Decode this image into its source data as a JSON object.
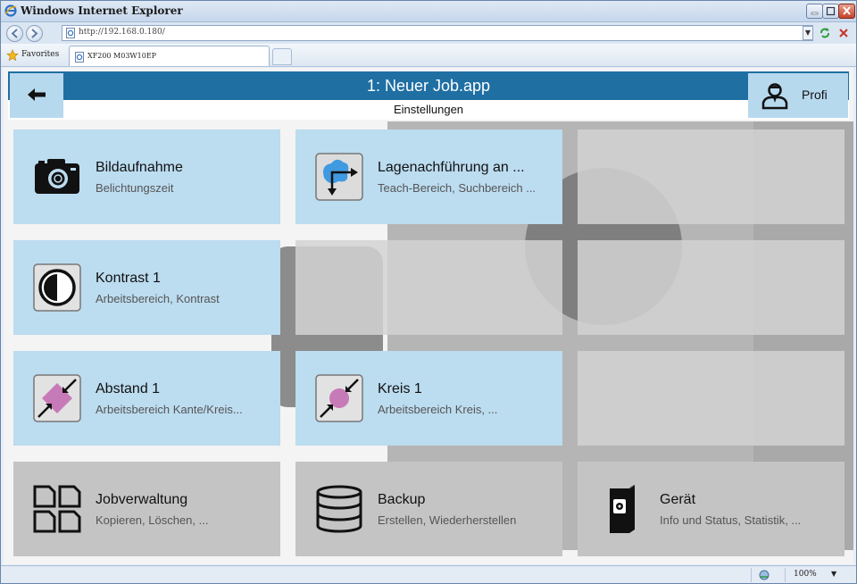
{
  "window": {
    "title": "Windows Internet Explorer"
  },
  "address_bar": {
    "url": "http://192.168.0.180/"
  },
  "favorites": {
    "label": "Favorites",
    "tab_label": "XF200 M03W10EP"
  },
  "app": {
    "header_title": "1: Neuer Job.app",
    "subheader": "Einstellungen",
    "profile_label": "Profi"
  },
  "tiles": [
    {
      "title": "Bildaufnahme",
      "subtitle": "Belichtungszeit",
      "icon": "camera-icon"
    },
    {
      "title": "Lagenachführung an ...",
      "subtitle": "Teach-Bereich, Suchbereich ...",
      "icon": "position-tracking-icon"
    },
    {
      "title": "Kontrast 1",
      "subtitle": "Arbeitsbereich, Kontrast",
      "icon": "contrast-icon"
    },
    {
      "title": "Abstand 1",
      "subtitle": "Arbeitsbereich Kante/Kreis...",
      "icon": "distance-icon"
    },
    {
      "title": "Kreis 1",
      "subtitle": "Arbeitsbereich Kreis, ...",
      "icon": "circle-tool-icon"
    },
    {
      "title": "Jobverwaltung",
      "subtitle": "Kopieren, Löschen, ...",
      "icon": "files-icon"
    },
    {
      "title": "Backup",
      "subtitle": "Erstellen, Wiederherstellen",
      "icon": "database-icon"
    },
    {
      "title": "Gerät",
      "subtitle": "Info und Status, Statistik, ...",
      "icon": "device-icon"
    }
  ],
  "status_bar": {
    "zoom": "100%"
  }
}
